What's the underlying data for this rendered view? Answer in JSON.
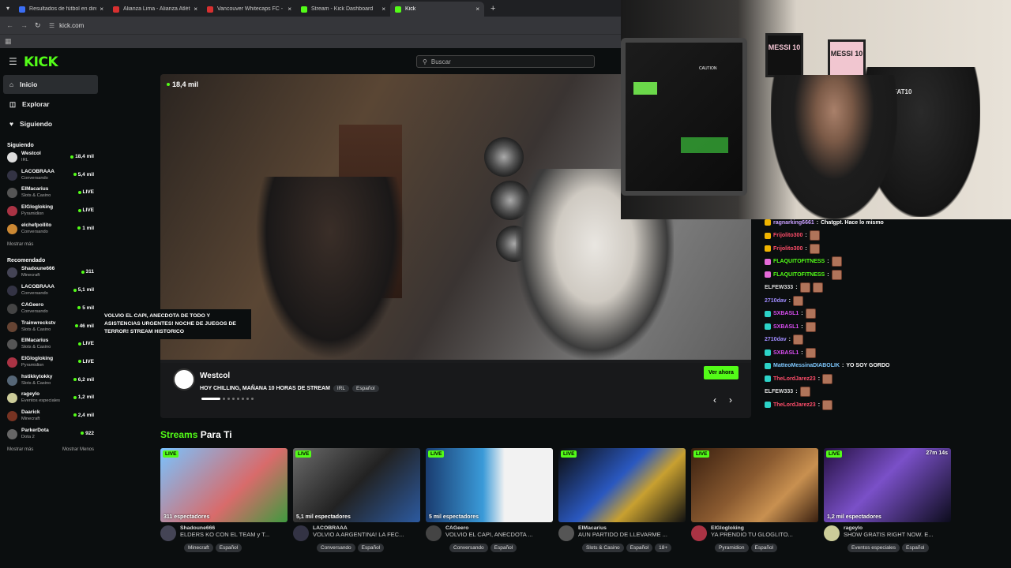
{
  "browser": {
    "tabs": [
      {
        "title": "Resultados de fútbol en directo",
        "color": "#3b6ef5"
      },
      {
        "title": "Alianza Lima - Alianza Atlético",
        "color": "#d83030"
      },
      {
        "title": "Vancouver Whitecaps FC - Los ...",
        "color": "#d83030"
      },
      {
        "title": "Stream - Kick Dashboard",
        "color": "#53fc18"
      },
      {
        "title": "Kick",
        "color": "#53fc18"
      }
    ],
    "url": "kick.com"
  },
  "header": {
    "logo": "KICK",
    "search_placeholder": "Buscar"
  },
  "sidebar": {
    "nav": [
      {
        "label": "Inicio",
        "icon": "home-icon"
      },
      {
        "label": "Explorar",
        "icon": "compass-icon"
      },
      {
        "label": "Siguiendo",
        "icon": "heart-icon"
      }
    ],
    "following_title": "Siguiendo",
    "following": [
      {
        "name": "Westcol",
        "category": "IRL",
        "viewers": "18,4 mil",
        "live": false,
        "color": "#ddd"
      },
      {
        "name": "LACOBRAAA",
        "category": "Conversando",
        "viewers": "5,4 mil",
        "live": false,
        "color": "#334"
      },
      {
        "name": "ElMacarius",
        "category": "Slots & Casino",
        "viewers": "LIVE",
        "live": true,
        "color": "#555"
      },
      {
        "name": "ElGlogloking",
        "category": "Pyramidion",
        "viewers": "LIVE",
        "live": true,
        "color": "#a34"
      },
      {
        "name": "elchefpollito",
        "category": "Conversando",
        "viewers": "1 mil",
        "live": false,
        "color": "#c83"
      }
    ],
    "show_more": "Mostrar más",
    "recommended_title": "Recomendado",
    "recommended": [
      {
        "name": "Shadoune666",
        "category": "Minecraft",
        "viewers": "311",
        "live": false,
        "color": "#445"
      },
      {
        "name": "LACOBRAAA",
        "category": "Conversando",
        "viewers": "5,1 mil",
        "live": false,
        "color": "#334"
      },
      {
        "name": "CAGeero",
        "category": "Conversando",
        "viewers": "5 mil",
        "live": false,
        "color": "#444"
      },
      {
        "name": "Trainwreckstv",
        "category": "Slots & Casino",
        "viewers": "46 mil",
        "live": false,
        "color": "#643"
      },
      {
        "name": "ElMacarius",
        "category": "Slots & Casino",
        "viewers": "LIVE",
        "live": true,
        "color": "#555"
      },
      {
        "name": "ElGlogloking",
        "category": "Pyramidion",
        "viewers": "LIVE",
        "live": true,
        "color": "#a34"
      },
      {
        "name": "hstikkytokky",
        "category": "Slots & Casino",
        "viewers": "6,2 mil",
        "live": false,
        "color": "#567"
      },
      {
        "name": "rageylo",
        "category": "Eventos especiales",
        "viewers": "1,2 mil",
        "live": false,
        "color": "#cc9"
      },
      {
        "name": "Daarick",
        "category": "Minecraft",
        "viewers": "2,4 mil",
        "live": false,
        "color": "#732"
      },
      {
        "name": "ParkerDota",
        "category": "Dota 2",
        "viewers": "922",
        "live": false,
        "color": "#666"
      }
    ],
    "show_more2": "Mostrar más",
    "show_less": "Mostrar Menos",
    "tooltip": "VOLVIO EL CAPI, ANECDOTA DE TODO Y ASISTENCIAS URGENTES! NOCHE DE JUEGOS DE TERROR! STREAM HISTORICO"
  },
  "featured": {
    "viewers": "18,4 mil",
    "name": "Westcol",
    "title": "HOY CHILLING, MAÑANA 10 HORAS DE STREAM",
    "tags": [
      "IRL",
      "Español"
    ],
    "cta": "Ver ahora"
  },
  "webcam": {
    "jersey1": "MESSI 10",
    "jersey2": "MESSI 10",
    "chair_label": "FAT10",
    "caution": "CAUTION"
  },
  "chat": [
    {
      "badge": "#f0b400",
      "user": "ragnarking6661",
      "text": "Chatgpt. Hace lo mismo",
      "color": "#c9a0ff",
      "emotes": 0
    },
    {
      "badge": "#f0b400",
      "user": "Frijolito300",
      "text": "",
      "color": "#ff4d6a",
      "emotes": 1
    },
    {
      "badge": "#f0b400",
      "user": "Frijolito300",
      "text": "",
      "color": "#ff4d6a",
      "emotes": 1
    },
    {
      "badge": "#e56ad8",
      "user": "FLAQUITOFITNESS",
      "text": "",
      "color": "#53fc18",
      "emotes": 1
    },
    {
      "badge": "#e56ad8",
      "user": "FLAQUITOFITNESS",
      "text": "",
      "color": "#53fc18",
      "emotes": 1
    },
    {
      "badge": "",
      "user": "ELFEW333",
      "text": "",
      "color": "#ddd",
      "emotes": 2
    },
    {
      "badge": "",
      "user": "2710dav",
      "text": "",
      "color": "#a08cff",
      "emotes": 1
    },
    {
      "badge": "#2cd3c8",
      "user": "SXBASL1",
      "text": "",
      "color": "#d84df0",
      "emotes": 1
    },
    {
      "badge": "#2cd3c8",
      "user": "SXBASL1",
      "text": "",
      "color": "#d84df0",
      "emotes": 1
    },
    {
      "badge": "",
      "user": "2710dav",
      "text": "",
      "color": "#a08cff",
      "emotes": 1
    },
    {
      "badge": "#2cd3c8",
      "user": "SXBASL1",
      "text": "",
      "color": "#d84df0",
      "emotes": 1
    },
    {
      "badge": "#2cd3c8",
      "user": "MatteoMessinaDIABOLIK",
      "text": "YO SOY GORDO",
      "color": "#7ec8ff",
      "emotes": 0
    },
    {
      "badge": "#2cd3c8",
      "user": "TheLordJarez23",
      "text": "",
      "color": "#ff4d6a",
      "emotes": 1
    },
    {
      "badge": "",
      "user": "ELFEW333",
      "text": "",
      "color": "#ddd",
      "emotes": 1
    },
    {
      "badge": "#2cd3c8",
      "user": "TheLordJarez23",
      "text": "",
      "color": "#ff4d6a",
      "emotes": 1
    }
  ],
  "streams": {
    "title_green": "Streams",
    "title_rest": "Para Ti",
    "cards": [
      {
        "spectators": "311 espectadores",
        "duration": "",
        "channel": "Shadoune666",
        "title": "ELDERS KO CON EL TEAM y T...",
        "tags": [
          "Minecraft",
          "Español"
        ],
        "bg": "linear-gradient(135deg,#79c3ff,#d86b6b 60%,#3f9a3f)"
      },
      {
        "spectators": "5,1 mil espectadores",
        "duration": "",
        "channel": "LACOBRAAA",
        "title": "VOLVIO A ARGENTINA! LA FEC...",
        "tags": [
          "Conversando",
          "Español"
        ],
        "bg": "linear-gradient(135deg,#6b6b6b,#222 50%,#2c5aa0)"
      },
      {
        "spectators": "5 mil espectadores",
        "duration": "",
        "channel": "CAGeero",
        "title": "VOLVIO EL CAPI, ANECDOTA ...",
        "tags": [
          "Conversando",
          "Español"
        ],
        "bg": "linear-gradient(90deg,#1a3c70,#3a9ad8 45%,#f2f2f2 62%)"
      },
      {
        "spectators": "",
        "duration": "",
        "channel": "ElMacarius",
        "title": "AUN PARTIDO DE LLEVARME ...",
        "tags": [
          "Slots & Casino",
          "Español",
          "18+"
        ],
        "bg": "linear-gradient(135deg,#0c0c0c,#2a58c0 45%,#c8a030 65%,#111)"
      },
      {
        "spectators": "",
        "duration": "",
        "channel": "ElGlogloking",
        "title": "YA PRENDIO TU GLOGLITO...",
        "tags": [
          "Pyramidion",
          "Español"
        ],
        "bg": "linear-gradient(135deg,#3a2010,#8a5a30 45%,#c89050 70%,#3a2010)"
      },
      {
        "spectators": "1,2 mil espectadores",
        "duration": "27m 14s",
        "channel": "rageylo",
        "title": "SHOW GRATIS RIGHT NOW. E...",
        "tags": [
          "Eventos especiales",
          "Español"
        ],
        "bg": "linear-gradient(135deg,#241040,#7a50c8 45%,#0c0c1c)"
      }
    ]
  }
}
